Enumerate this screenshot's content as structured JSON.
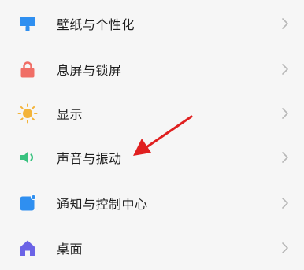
{
  "settings": {
    "items": [
      {
        "label": "壁纸与个性化",
        "icon": "wallpaper-icon",
        "color": "#2f8ff0"
      },
      {
        "label": "息屏与锁屏",
        "icon": "lock-icon",
        "color": "#f06e66"
      },
      {
        "label": "显示",
        "icon": "sun-icon",
        "color": "#f3b43a"
      },
      {
        "label": "声音与振动",
        "icon": "speaker-icon",
        "color": "#39c27f"
      },
      {
        "label": "通知与控制中心",
        "icon": "notification-icon",
        "color": "#2f8ff0"
      },
      {
        "label": "桌面",
        "icon": "home-icon",
        "color": "#6b63e6"
      }
    ]
  },
  "annotation": {
    "color": "#e02020",
    "target_item": "声音与振动"
  }
}
